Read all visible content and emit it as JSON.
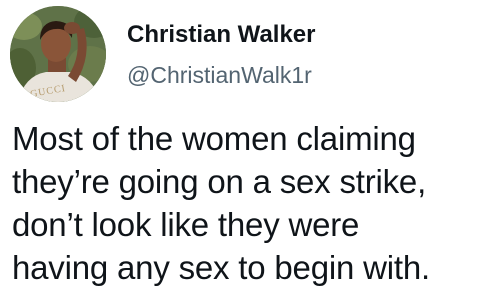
{
  "author": {
    "display_name": "Christian Walker",
    "handle": "@ChristianWalk1r",
    "avatar_icon": "profile-photo",
    "avatar_shirt_text": "GUCCI"
  },
  "tweet": {
    "lines": [
      "Most of the women claiming",
      "they’re going on a sex strike,",
      "don’t look like they were",
      "having any sex to begin with."
    ]
  },
  "colors": {
    "text_primary": "#0f1419",
    "text_secondary": "#536471",
    "background": "#ffffff"
  }
}
